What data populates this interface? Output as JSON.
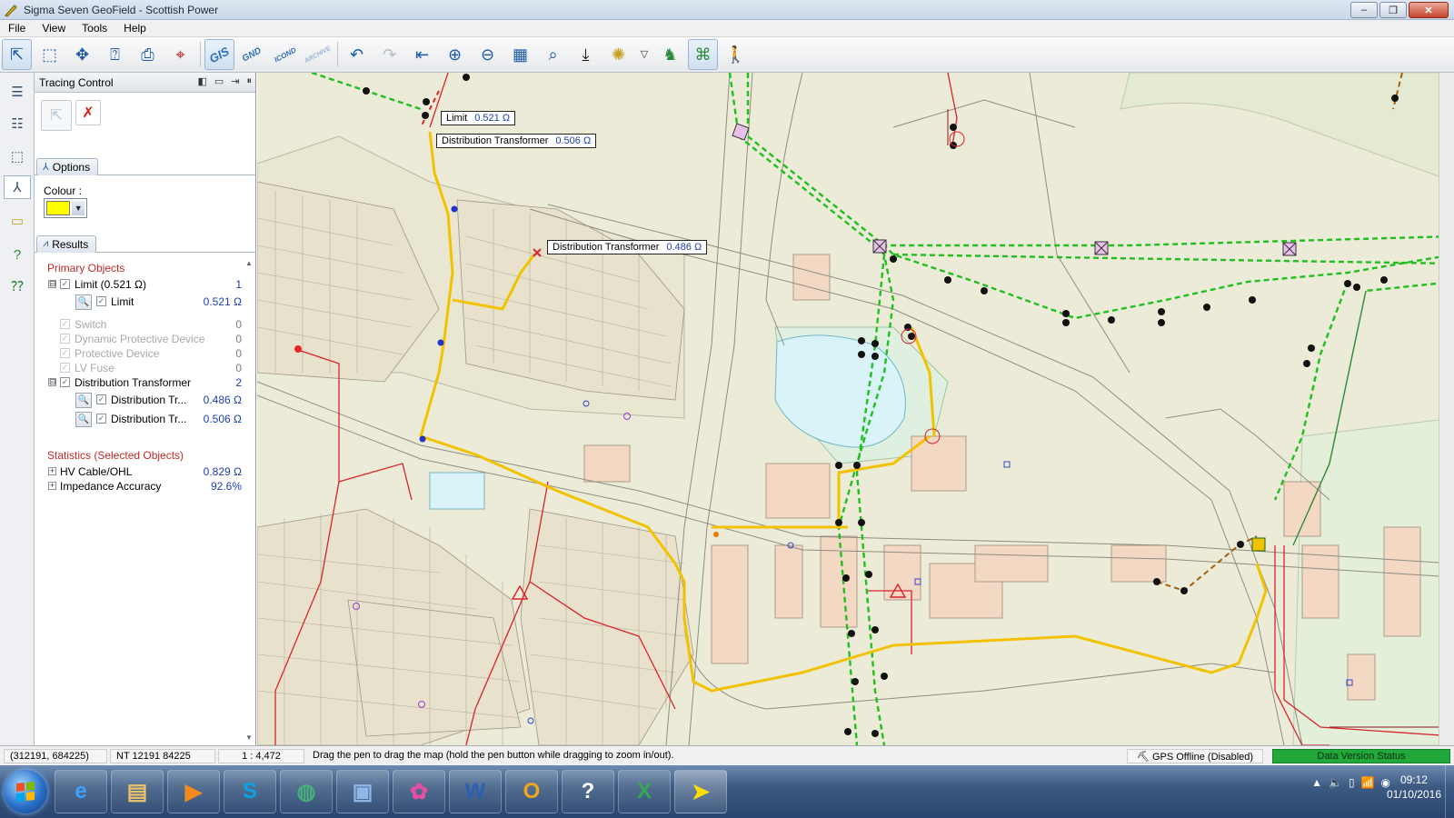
{
  "window": {
    "title": "Sigma Seven GeoField - Scottish Power",
    "min": "–",
    "max": "❐",
    "close": "✕"
  },
  "menu": [
    "File",
    "View",
    "Tools",
    "Help"
  ],
  "toolbar": {
    "gis": "GIS",
    "gnd": "GND",
    "icond": "ICOND",
    "archive": "ARCHIVE",
    "icons": [
      "select-arrow-icon",
      "select-area-icon",
      "move-select-icon",
      "query-select-icon",
      "print-icon",
      "coordinates-icon",
      "undo-icon",
      "redo-icon",
      "zoom-previous-icon",
      "zoom-in-icon",
      "zoom-out-icon",
      "map-view-icon",
      "find-icon",
      "download-icon",
      "settings-icon",
      "dropdown-icon",
      "trace-person-icon",
      "network-icon",
      "user-icon"
    ]
  },
  "panel": {
    "title": "Tracing Control",
    "options_tab": "Options",
    "results_tab": "Results",
    "colour_label": "Colour :",
    "colour": "#ffff00",
    "primary_heading": "Primary Objects",
    "rows": [
      {
        "label": "Limit (0.521 Ω)",
        "value": "1",
        "level": 0,
        "enabled": true,
        "expander": "⊟"
      },
      {
        "label": "Limit",
        "value": "0.521 Ω",
        "level": 1,
        "enabled": true
      },
      {
        "label": "Switch",
        "value": "0",
        "level": 0,
        "enabled": false
      },
      {
        "label": "Dynamic Protective Device",
        "value": "0",
        "level": 0,
        "enabled": false
      },
      {
        "label": "Protective Device",
        "value": "0",
        "level": 0,
        "enabled": false
      },
      {
        "label": "LV Fuse",
        "value": "0",
        "level": 0,
        "enabled": false
      },
      {
        "label": "Distribution Transformer",
        "value": "2",
        "level": 0,
        "enabled": true,
        "expander": "⊟"
      },
      {
        "label": "Distribution Tr...",
        "value": "0.486 Ω",
        "level": 1,
        "enabled": true
      },
      {
        "label": "Distribution Tr...",
        "value": "0.506 Ω",
        "level": 1,
        "enabled": true
      }
    ],
    "stats_heading": "Statistics (Selected Objects)",
    "stats": [
      {
        "label": "HV Cable/OHL",
        "value": "0.829 Ω"
      },
      {
        "label": "Impedance Accuracy",
        "value": "92.6%"
      }
    ]
  },
  "map": {
    "tooltips": [
      {
        "label": "Limit",
        "value": "0.521 Ω"
      },
      {
        "label": "Distribution Transformer",
        "value": "0.506 Ω"
      },
      {
        "label": "Distribution Transformer",
        "value": "0.486 Ω"
      }
    ]
  },
  "status": {
    "coords": "(312191, 684225)",
    "grid_ref": "NT 12191 84225",
    "scale": "1 : 4,472",
    "hint": "Drag the pen to drag the map (hold the pen button while dragging to zoom in/out).",
    "gps": "GPS Offline (Disabled)",
    "data_version": "Data Version Status"
  },
  "taskbar": {
    "apps": [
      "ie-icon",
      "explorer-icon",
      "media-player-icon",
      "skype-icon",
      "network-globe-icon",
      "remote-desktop-icon",
      "paint-icon",
      "word-icon",
      "outlook-icon",
      "help-icon",
      "excel-icon",
      "geofield-icon"
    ],
    "time": "09:12",
    "date": "01/10/2016"
  }
}
